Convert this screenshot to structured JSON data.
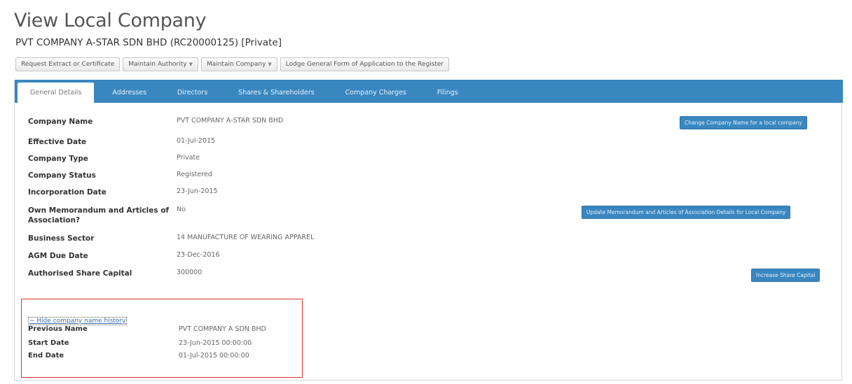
{
  "page": {
    "title": "View Local Company",
    "subtitle": "PVT COMPANY A-STAR SDN BHD (RC20000125) [Private]"
  },
  "actions": {
    "request_extract": "Request Extract or Certificate",
    "maintain_authority": "Maintain Authority",
    "maintain_company": "Maintain Company",
    "lodge_general_form": "Lodge General Form of Application to the Register"
  },
  "tabs": [
    {
      "label": "General Details",
      "active": true
    },
    {
      "label": "Addresses"
    },
    {
      "label": "Directors"
    },
    {
      "label": "Shares & Shareholders"
    },
    {
      "label": "Company Charges"
    },
    {
      "label": "Filings"
    }
  ],
  "details": {
    "company_name": {
      "label": "Company Name",
      "value": "PVT COMPANY A-STAR SDN BHD"
    },
    "effective_date": {
      "label": "Effective Date",
      "value": "01-Jul-2015"
    },
    "company_type": {
      "label": "Company Type",
      "value": "Private"
    },
    "company_status": {
      "label": "Company Status",
      "value": "Registered"
    },
    "incorporation_date": {
      "label": "Incorporation Date",
      "value": "23-Jun-2015"
    },
    "own_memorandum": {
      "label": "Own Memorandum and Articles of Association?",
      "value": "No"
    },
    "business_sector": {
      "label": "Business Sector",
      "value": "14 MANUFACTURE OF WEARING APPAREL"
    },
    "agm_due_date": {
      "label": "AGM Due Date",
      "value": "23-Dec-2016"
    },
    "authorised_share_capital": {
      "label": "Authorised Share Capital",
      "value": "300000"
    }
  },
  "buttons": {
    "change_name": "Change Company Name for a local company",
    "update_memorandum": "Update Memorandum and Articles of Association Details for Local Company",
    "increase_capital": "Increase Share Capital"
  },
  "history": {
    "toggle_label": "− Hide company name history",
    "previous_name": {
      "label": "Previous Name",
      "value": "PVT COMPANY A SDN BHD"
    },
    "start_date": {
      "label": "Start Date",
      "value": "23-Jun-2015 00:00:00"
    },
    "end_date": {
      "label": "End Date",
      "value": "01-Jul-2015 00:00:00"
    }
  },
  "colors": {
    "accent": "#3a87c0",
    "highlight_border": "#dd3333"
  }
}
